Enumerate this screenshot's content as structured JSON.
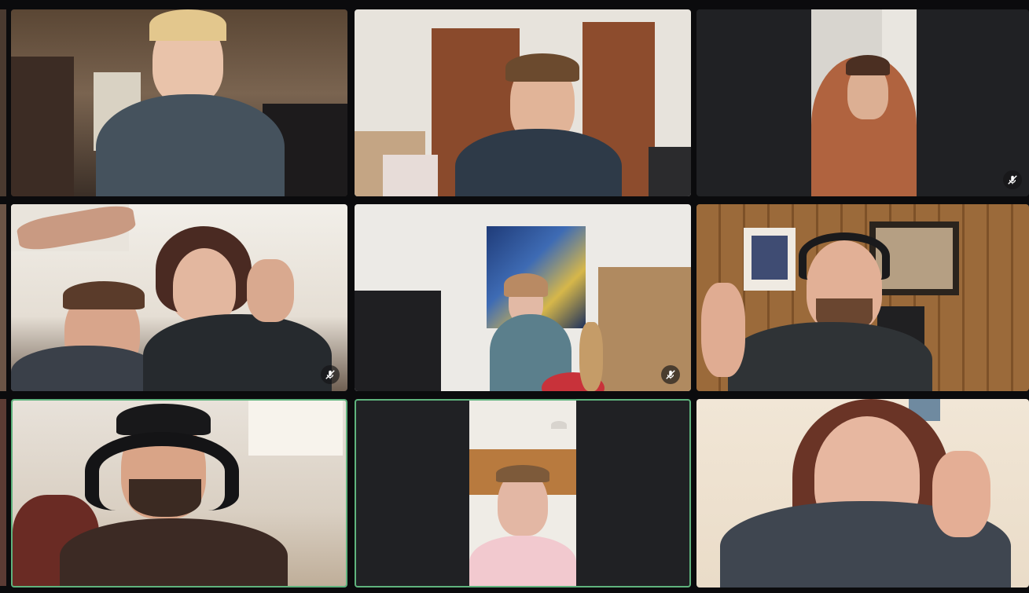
{
  "meeting": {
    "layout": "grid-3x3",
    "accent_color": "#5fb37d",
    "tile_background": "#202124"
  },
  "participants": [
    {
      "tile": "r1c1",
      "feed": "landscape",
      "muted": false,
      "active_speaker": false,
      "icon": "mic-off-icon"
    },
    {
      "tile": "r1c2",
      "feed": "landscape",
      "muted": false,
      "active_speaker": false,
      "icon": "mic-off-icon"
    },
    {
      "tile": "r1c3",
      "feed": "portrait",
      "muted": true,
      "active_speaker": false,
      "icon": "mic-off-icon"
    },
    {
      "tile": "r2c1",
      "feed": "landscape",
      "muted": true,
      "active_speaker": false,
      "icon": "mic-off-icon"
    },
    {
      "tile": "r2c2",
      "feed": "landscape",
      "muted": true,
      "active_speaker": false,
      "icon": "mic-off-icon"
    },
    {
      "tile": "r2c3",
      "feed": "landscape",
      "muted": false,
      "active_speaker": false,
      "icon": "mic-off-icon"
    },
    {
      "tile": "r3c1",
      "feed": "landscape",
      "muted": false,
      "active_speaker": true,
      "icon": "mic-off-icon"
    },
    {
      "tile": "r3c2",
      "feed": "portrait",
      "muted": false,
      "active_speaker": true,
      "icon": "mic-off-icon"
    },
    {
      "tile": "r3c3",
      "feed": "landscape",
      "muted": false,
      "active_speaker": false,
      "icon": "mic-off-icon"
    }
  ]
}
